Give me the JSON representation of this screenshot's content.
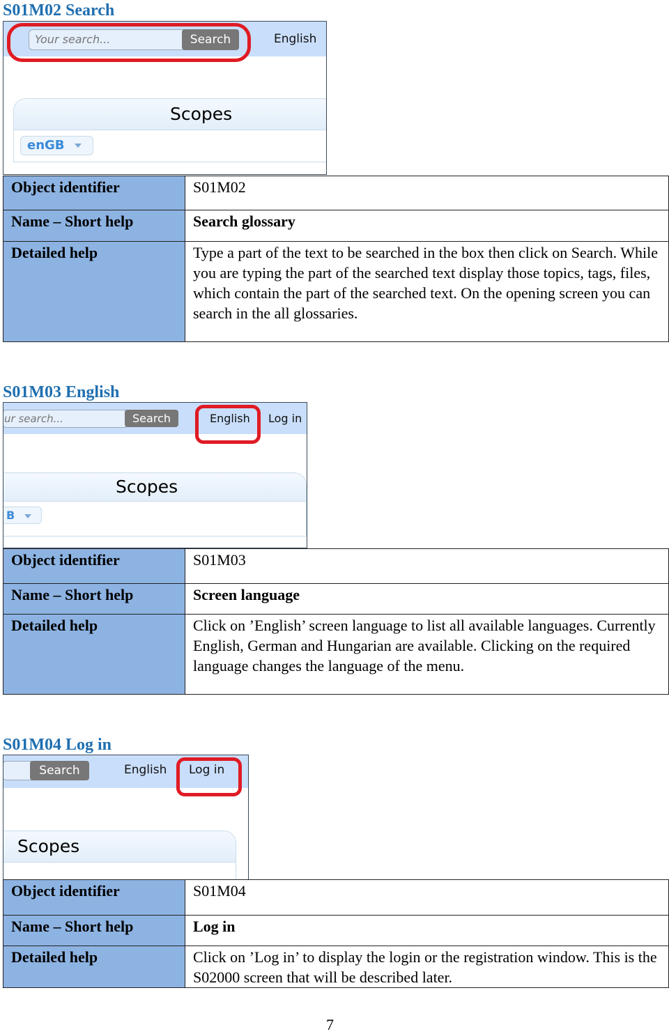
{
  "colors": {
    "heading": "#1f6fb0",
    "label_cell": "#8db3e2",
    "highlight": "#e01b24",
    "toolbar": "#c9defa"
  },
  "labels": {
    "object_identifier": "Object identifier",
    "name_short_help": "Name – Short help",
    "detailed_help": "Detailed help"
  },
  "sections": [
    {
      "heading": "S01M02 Search",
      "mock": {
        "search_placeholder": "Your search...",
        "search_button": "Search",
        "language": "English",
        "scopes": "Scopes",
        "locale": "enGB"
      },
      "object_identifier": "S01M02",
      "short_help": "Search glossary",
      "detailed_help": "Type a part of the text to be searched in the box then click on Search. While you are typing the part of the searched text display those topics, tags, files, which contain the part of the searched text. On the opening screen you can search in the all glossaries."
    },
    {
      "heading": "S01M03 English",
      "mock": {
        "search_placeholder": "ur search...",
        "search_button": "Search",
        "language": "English",
        "login": "Log in",
        "scopes": "Scopes",
        "locale": "B"
      },
      "object_identifier": "S01M03",
      "short_help": "Screen language",
      "detailed_help": "Click on ’English’ screen language to list all available languages. Currently English, German and Hungarian are available. Clicking on the required language changes the language of the menu."
    },
    {
      "heading": "S01M04 Log in",
      "mock": {
        "search_button": "Search",
        "language": "English",
        "login": "Log in",
        "scopes": "Scopes"
      },
      "object_identifier": "S01M04",
      "short_help": "Log in",
      "detailed_help": "Click on ’Log in’ to display the login or the registration window. This is the S02000 screen that will be described later."
    }
  ],
  "page_number": "7"
}
